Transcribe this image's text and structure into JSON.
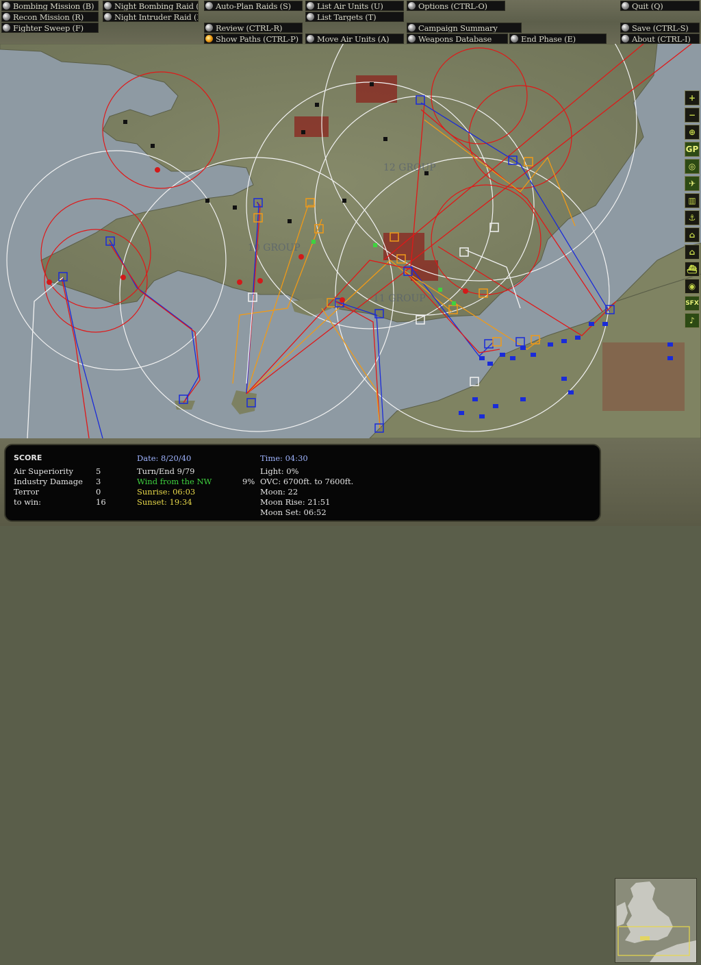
{
  "menu": {
    "bombing_mission": "Bombing Mission (B)",
    "recon_mission": "Recon Mission (R)",
    "fighter_sweep": "Fighter Sweep (F)",
    "night_bombing_raid": "Night Bombing Raid (N)",
    "night_intruder_raid": "Night Intruder Raid (I)",
    "auto_plan_raids": "Auto-Plan Raids (S)",
    "review": "Review (CTRL-R)",
    "show_paths": "Show Paths (CTRL-P)",
    "list_air_units": "List Air Units (U)",
    "list_targets": "List Targets (T)",
    "move_air_units": "Move Air Units (A)",
    "options": "Options (CTRL-O)",
    "campaign_summary": "Campaign Summary",
    "weapons_database": "Weapons Database",
    "end_phase": "End Phase (E)",
    "quit": "Quit (Q)",
    "save": "Save (CTRL-S)",
    "about": "About (CTRL-I)"
  },
  "map": {
    "group_labels": [
      "12 GROUP",
      "10 GROUP",
      "11 GROUP"
    ]
  },
  "toolbar": {
    "zoom_in": "+",
    "zoom_out": "−",
    "center": "⊕",
    "gp": "GP",
    "target": "◎",
    "aircraft": "✈",
    "factory": "▥",
    "port": "⚓",
    "airfield": "⌂",
    "city": "⌂",
    "ship": "⛴",
    "radar": "◉",
    "sfx": "SFX",
    "music": "♪"
  },
  "score": {
    "title": "SCORE",
    "rows": [
      {
        "label": "Air Superiority",
        "value": "5"
      },
      {
        "label": "Industry Damage",
        "value": "3"
      },
      {
        "label": "Terror",
        "value": "0"
      },
      {
        "label": "to win:",
        "value": "16"
      }
    ]
  },
  "date": {
    "label": "Date: 8/20/40",
    "turn": "Turn/End 9/79",
    "wind": "Wind from the NW",
    "sunrise": "Sunrise: 06:03",
    "sunset": "Sunset: 19:34"
  },
  "weather": {
    "cloud_pct": "9%",
    "time": "Time: 04:30",
    "light": "Light: 0%",
    "ovc": "OVC: 6700ft. to 7600ft.",
    "moon": "Moon: 22",
    "moon_rise": "Moon Rise: 21:51",
    "moon_set": "Moon Set: 06:52"
  },
  "colors": {
    "sea": "#8e9aa3",
    "land": "#7d8162",
    "raf_blue": "#1a2bd8",
    "red_route": "#e01818",
    "orange_route": "#f09a18",
    "white_ring": "#f2f2f2"
  }
}
